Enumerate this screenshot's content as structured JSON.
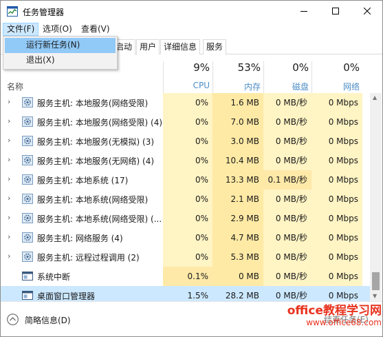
{
  "window": {
    "title": "任务管理器",
    "controls": {
      "minimize": "minimize-icon",
      "maximize": "maximize-icon",
      "close": "close-icon"
    }
  },
  "menu": {
    "file": "文件(F)",
    "options": "选项(O)",
    "view": "查看(V)"
  },
  "file_menu": {
    "run_new_task": "运行新任务(N)",
    "exit": "退出(X)"
  },
  "tabs": {
    "startup": "启动",
    "users": "用户",
    "details": "详细信息",
    "services": "服务"
  },
  "columns": {
    "name": "名称",
    "cpu": {
      "percent": "9%",
      "label": "CPU"
    },
    "memory": {
      "percent": "53%",
      "label": "内存"
    },
    "disk": {
      "percent": "0%",
      "label": "磁盘"
    },
    "network": {
      "percent": "0%",
      "label": "网络"
    }
  },
  "processes": [
    {
      "name": "服务主机: 本地服务(网络受限)",
      "cpu": "0%",
      "memory": "1.6 MB",
      "disk": "0 MB/秒",
      "network": "0 Mbps",
      "expandable": true,
      "icon": "gear-icon"
    },
    {
      "name": "服务主机: 本地服务(网络受限) (4)",
      "cpu": "0%",
      "memory": "7.0 MB",
      "disk": "0 MB/秒",
      "network": "0 Mbps",
      "expandable": true,
      "icon": "gear-icon"
    },
    {
      "name": "服务主机: 本地服务(无模拟) (3)",
      "cpu": "0%",
      "memory": "3.0 MB",
      "disk": "0 MB/秒",
      "network": "0 Mbps",
      "expandable": true,
      "icon": "gear-icon"
    },
    {
      "name": "服务主机: 本地服务(无网络) (4)",
      "cpu": "0%",
      "memory": "10.4 MB",
      "disk": "0 MB/秒",
      "network": "0 Mbps",
      "expandable": true,
      "icon": "gear-icon"
    },
    {
      "name": "服务主机: 本地系统 (17)",
      "cpu": "0%",
      "memory": "13.3 MB",
      "disk": "0.1 MB/秒",
      "network": "0 Mbps",
      "expandable": true,
      "icon": "gear-icon"
    },
    {
      "name": "服务主机: 本地系统(网络受限)",
      "cpu": "0%",
      "memory": "2.1 MB",
      "disk": "0 MB/秒",
      "network": "0 Mbps",
      "expandable": true,
      "icon": "gear-icon"
    },
    {
      "name": "服务主机: 本地系统(网络受限) (...",
      "cpu": "0%",
      "memory": "2.9 MB",
      "disk": "0 MB/秒",
      "network": "0 Mbps",
      "expandable": true,
      "icon": "gear-icon"
    },
    {
      "name": "服务主机: 网络服务 (4)",
      "cpu": "0%",
      "memory": "4.7 MB",
      "disk": "0 MB/秒",
      "network": "0 Mbps",
      "expandable": true,
      "icon": "gear-icon"
    },
    {
      "name": "服务主机: 远程过程调用 (2)",
      "cpu": "0%",
      "memory": "5.3 MB",
      "disk": "0 MB/秒",
      "network": "0 Mbps",
      "expandable": true,
      "icon": "gear-icon"
    },
    {
      "name": "系统中断",
      "cpu": "0.1%",
      "memory": "0 MB",
      "disk": "0 MB/秒",
      "network": "0 Mbps",
      "expandable": false,
      "icon": "window-icon"
    },
    {
      "name": "桌面窗口管理器",
      "cpu": "1.5%",
      "memory": "28.2 MB",
      "disk": "0 MB/秒",
      "network": "0 Mbps",
      "expandable": false,
      "icon": "window-icon",
      "selected": true
    }
  ],
  "footer": {
    "fewer_details": "简略信息(D)",
    "end_task": "结束任务(E)"
  },
  "watermark": {
    "main": "office教程学习网",
    "url": "www.office68.com"
  },
  "colors": {
    "selection": "#cce8ff",
    "menu_highlight": "#91c9f7",
    "heat_light": "#fff4c4",
    "heat_mid": "#ffeaa5",
    "watermark": "#e8321e"
  }
}
